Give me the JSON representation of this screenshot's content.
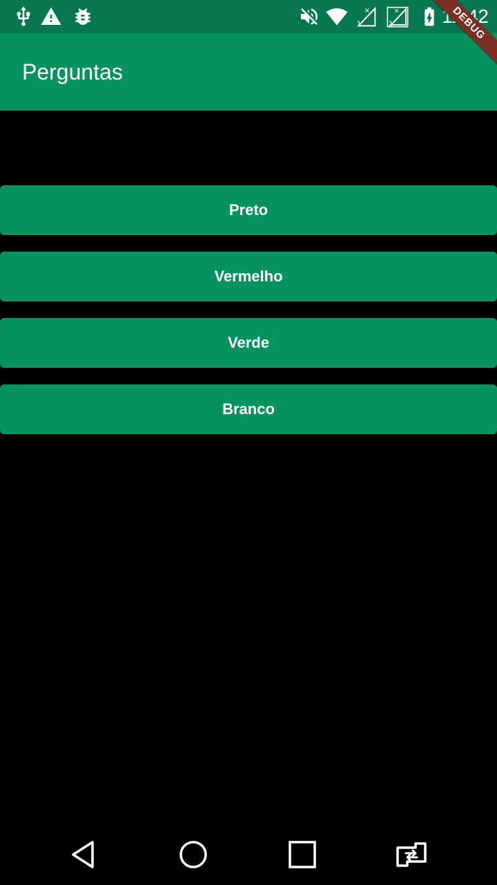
{
  "status_bar": {
    "time": "11:42",
    "icons": [
      "usb-icon",
      "warning-icon",
      "android-debug-icon",
      "mute-icon",
      "wifi-icon",
      "signal-sim1-icon",
      "signal-sim2-icon",
      "battery-charging-icon"
    ]
  },
  "app_bar": {
    "title": "Perguntas"
  },
  "debug_banner": {
    "label": "DEBUG"
  },
  "answers": [
    {
      "label": "Preto"
    },
    {
      "label": "Vermelho"
    },
    {
      "label": "Verde"
    },
    {
      "label": "Branco"
    }
  ],
  "nav_bar": {
    "buttons": [
      "back-icon",
      "home-icon",
      "recents-icon",
      "rotate-icon"
    ]
  },
  "colors": {
    "status_bar": "#06774f",
    "primary": "#07935f",
    "background": "#000000",
    "debug_banner": "#7a2f25"
  }
}
